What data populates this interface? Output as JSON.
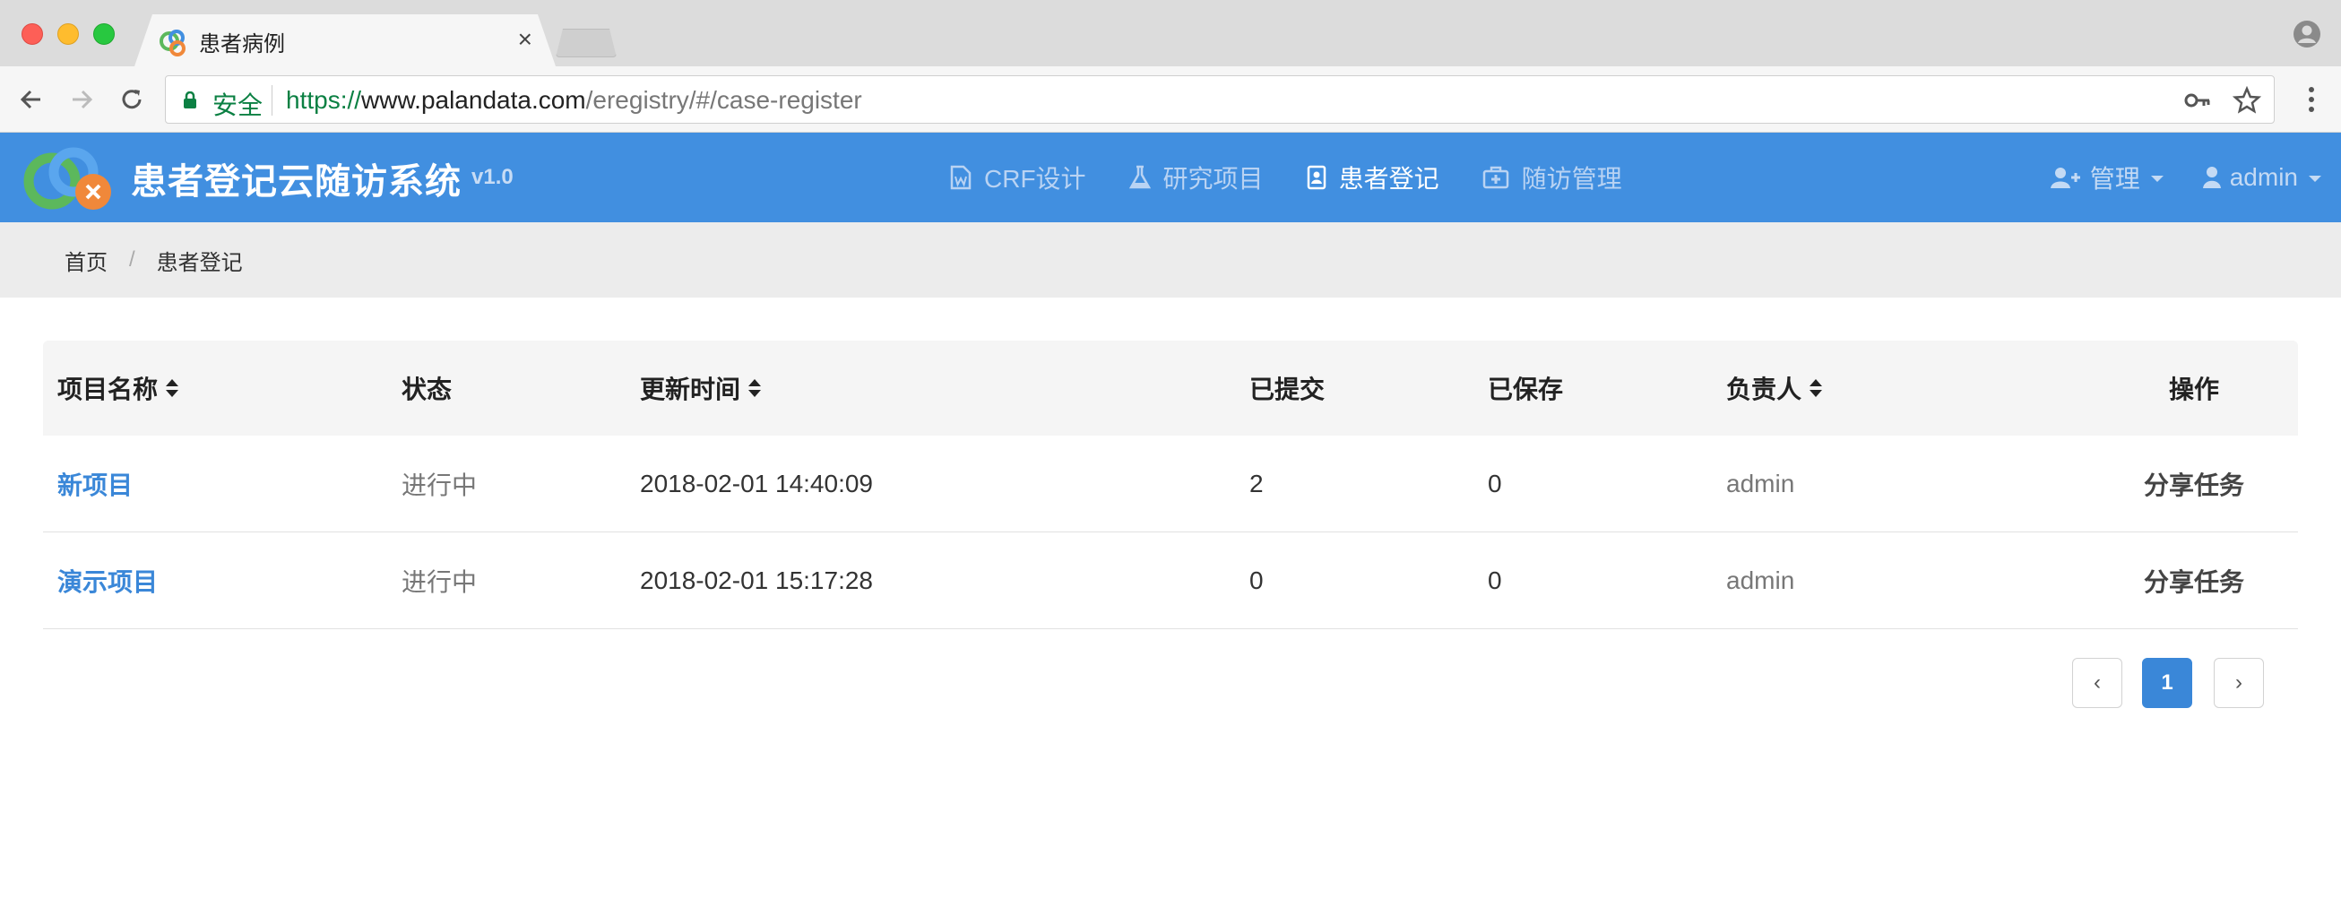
{
  "browser": {
    "tab_title": "患者病例",
    "tab_close": "×",
    "secure_label": "安全",
    "url_scheme": "https://",
    "url_host": "www.palandata.com",
    "url_path": "/eregistry/#/case-register"
  },
  "header": {
    "title": "患者登记云随访系统",
    "version": "v1.0",
    "nav": [
      {
        "label": "CRF设计",
        "icon": "file-word-icon"
      },
      {
        "label": "研究项目",
        "icon": "flask-icon"
      },
      {
        "label": "患者登记",
        "icon": "id-card-icon",
        "active": true
      },
      {
        "label": "随访管理",
        "icon": "medkit-icon"
      }
    ],
    "manage_label": "管理",
    "user_label": "admin"
  },
  "breadcrumb": {
    "home": "首页",
    "separator": "/",
    "current": "患者登记"
  },
  "table": {
    "columns": [
      "项目名称",
      "状态",
      "更新时间",
      "已提交",
      "已保存",
      "负责人",
      "操作"
    ],
    "rows": [
      {
        "name": "新项目",
        "status": "进行中",
        "updated": "2018-02-01 14:40:09",
        "submitted": "2",
        "saved": "0",
        "owner": "admin",
        "action": "分享任务"
      },
      {
        "name": "演示项目",
        "status": "进行中",
        "updated": "2018-02-01 15:17:28",
        "submitted": "0",
        "saved": "0",
        "owner": "admin",
        "action": "分享任务"
      }
    ]
  },
  "pagination": {
    "prev": "‹",
    "current_page": "1",
    "next": "›"
  },
  "colors": {
    "header_bg": "#418fe0",
    "link": "#3a87d8",
    "secure_green": "#0b8043"
  }
}
